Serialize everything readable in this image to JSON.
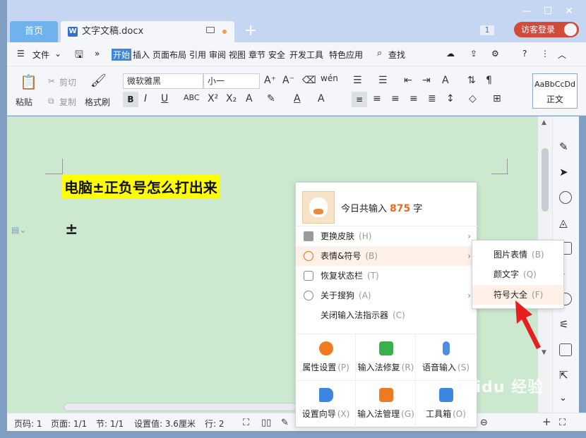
{
  "tabs": {
    "home": "首页",
    "doc_name": "文字文稿.docx",
    "new_tab": "+"
  },
  "window": {
    "minimize": "—",
    "maximize": "☐",
    "close": "✕",
    "count_badge": "1",
    "guest_login": "访客登录"
  },
  "menu": {
    "file": "文件",
    "more": "»",
    "items": [
      "开始",
      "插入",
      "页面布局",
      "引用",
      "审阅",
      "视图",
      "章节",
      "安全",
      "开发工具",
      "特色应用"
    ],
    "search": "查找",
    "help": "?",
    "more_dots": "⋮"
  },
  "ribbon": {
    "paste": "粘贴",
    "cut": "剪切",
    "copy": "复制",
    "format_painter": "格式刷",
    "font_name": "微软雅黑",
    "font_size": "小一",
    "style_preview": "AaBbCcDd",
    "style_name": "正文"
  },
  "document": {
    "heading": "电脑±正负号怎么打出来",
    "symbol": "±"
  },
  "popup": {
    "today_prefix": "今日共输入",
    "today_count": "875",
    "today_unit": "字",
    "items": [
      {
        "label": "更换皮肤",
        "shortcut": "(H)",
        "arrow": "›"
      },
      {
        "label": "表情&符号",
        "shortcut": "(B)",
        "arrow": "›"
      },
      {
        "label": "恢复状态栏",
        "shortcut": "(T)",
        "arrow": ""
      },
      {
        "label": "关于搜狗",
        "shortcut": "(A)",
        "arrow": "›"
      },
      {
        "label": "关闭输入法指示器",
        "shortcut": "(C)",
        "arrow": ""
      }
    ],
    "grid": [
      {
        "label": "属性设置",
        "shortcut": "(P)"
      },
      {
        "label": "输入法修复",
        "shortcut": "(R)"
      },
      {
        "label": "语音输入",
        "shortcut": "(S)"
      },
      {
        "label": "设置向导",
        "shortcut": "(X)"
      },
      {
        "label": "输入法管理",
        "shortcut": "(G)"
      },
      {
        "label": "工具箱",
        "shortcut": "(O)"
      }
    ]
  },
  "submenu": {
    "items": [
      {
        "label": "图片表情",
        "shortcut": "(B)"
      },
      {
        "label": "颜文字",
        "shortcut": "(Q)"
      },
      {
        "label": "符号大全",
        "shortcut": "(F)"
      }
    ]
  },
  "status": {
    "page_no": "页码: 1",
    "pages": "页面: 1/1",
    "section": "节: 1/1",
    "setting": "设置值: 3.6厘米",
    "row": "行: 2",
    "zoom_plus": "+"
  },
  "watermark": "Baidu 经验",
  "colors": {
    "accent": "#3a86e0",
    "highlight": "#ffff00",
    "doc_bg": "#cce8cf",
    "arrow": "#e81e1e",
    "count": "#f06a1e"
  }
}
